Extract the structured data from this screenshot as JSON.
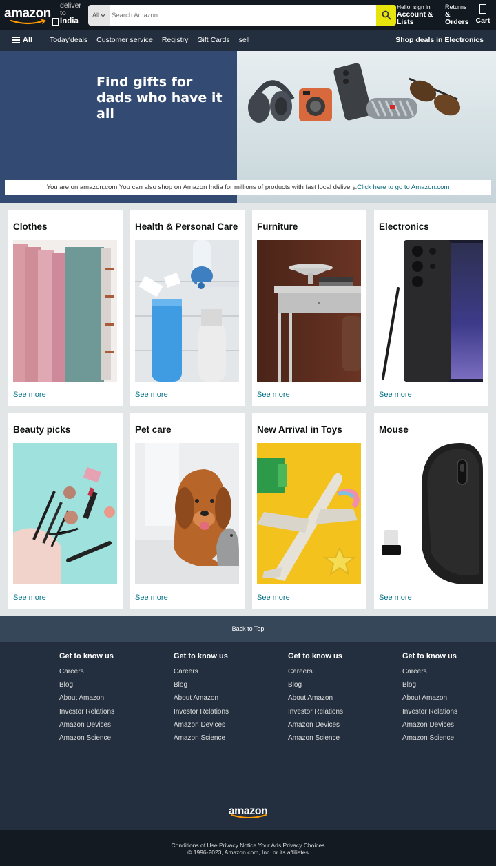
{
  "header": {
    "logo_text": "amazon",
    "deliver_line1": "deliver",
    "deliver_line2": "to",
    "location": "India",
    "search_category": "All",
    "search_placeholder": "Search Amazon",
    "account_greeting": "Hello, sign in",
    "account_label": "Account & Lists",
    "returns_label": "Returns",
    "orders_label": "& Orders",
    "cart_label": "Cart"
  },
  "subnav": {
    "all_label": "All",
    "links": [
      "Today'deals",
      "Customer service",
      "Registry",
      "Gift Cards",
      "sell"
    ],
    "deals_label": "Shop deals in Electronics"
  },
  "hero": {
    "title_line1": "Find gifts for",
    "title_line2": "dads who have it all",
    "notice_text": "You are on amazon.com.You can also shop on Amazon India for millions of products with fast local delivery.",
    "notice_link": "Click here to go to Amazon.com"
  },
  "cards": [
    {
      "title": "Clothes",
      "see_more": "See more"
    },
    {
      "title": "Health & Personal Care",
      "see_more": "See more"
    },
    {
      "title": "Furniture",
      "see_more": "See more"
    },
    {
      "title": "Electronics",
      "see_more": "See more"
    },
    {
      "title": "Beauty picks",
      "see_more": "See more"
    },
    {
      "title": "Pet care",
      "see_more": "See more"
    },
    {
      "title": "New Arrival in Toys",
      "see_more": "See more"
    },
    {
      "title": "Mouse",
      "see_more": "See more"
    }
  ],
  "footer": {
    "back_to_top": "Back to Top",
    "columns": [
      {
        "heading": "Get to know us",
        "links": [
          "Careers",
          "Blog",
          "About Amazon",
          "Investor Relations",
          "Amazon Devices",
          "Amazon Science"
        ]
      },
      {
        "heading": "Get to know us",
        "links": [
          "Careers",
          "Blog",
          "About Amazon",
          "Investor Relations",
          "Amazon Devices",
          "Amazon Science"
        ]
      },
      {
        "heading": "Get to know us",
        "links": [
          "Careers",
          "Blog",
          "About Amazon",
          "Investor Relations",
          "Amazon Devices",
          "Amazon Science"
        ]
      },
      {
        "heading": "Get to know us",
        "links": [
          "Careers",
          "Blog",
          "About Amazon",
          "Investor Relations",
          "Amazon Devices",
          "Amazon Science"
        ]
      }
    ],
    "logo_text": "amazon",
    "legal_line1": "Conditions of Use Privacy Notice Your Ads Privacy Choices",
    "legal_line2": "© 1996-2023, Amazon.com, Inc. or its affiliates"
  },
  "colors": {
    "nav_dark": "#131921",
    "subnav": "#232f3e",
    "search_button": "#e6e30d",
    "hero_left": "#334a73",
    "link_teal": "#007185"
  }
}
